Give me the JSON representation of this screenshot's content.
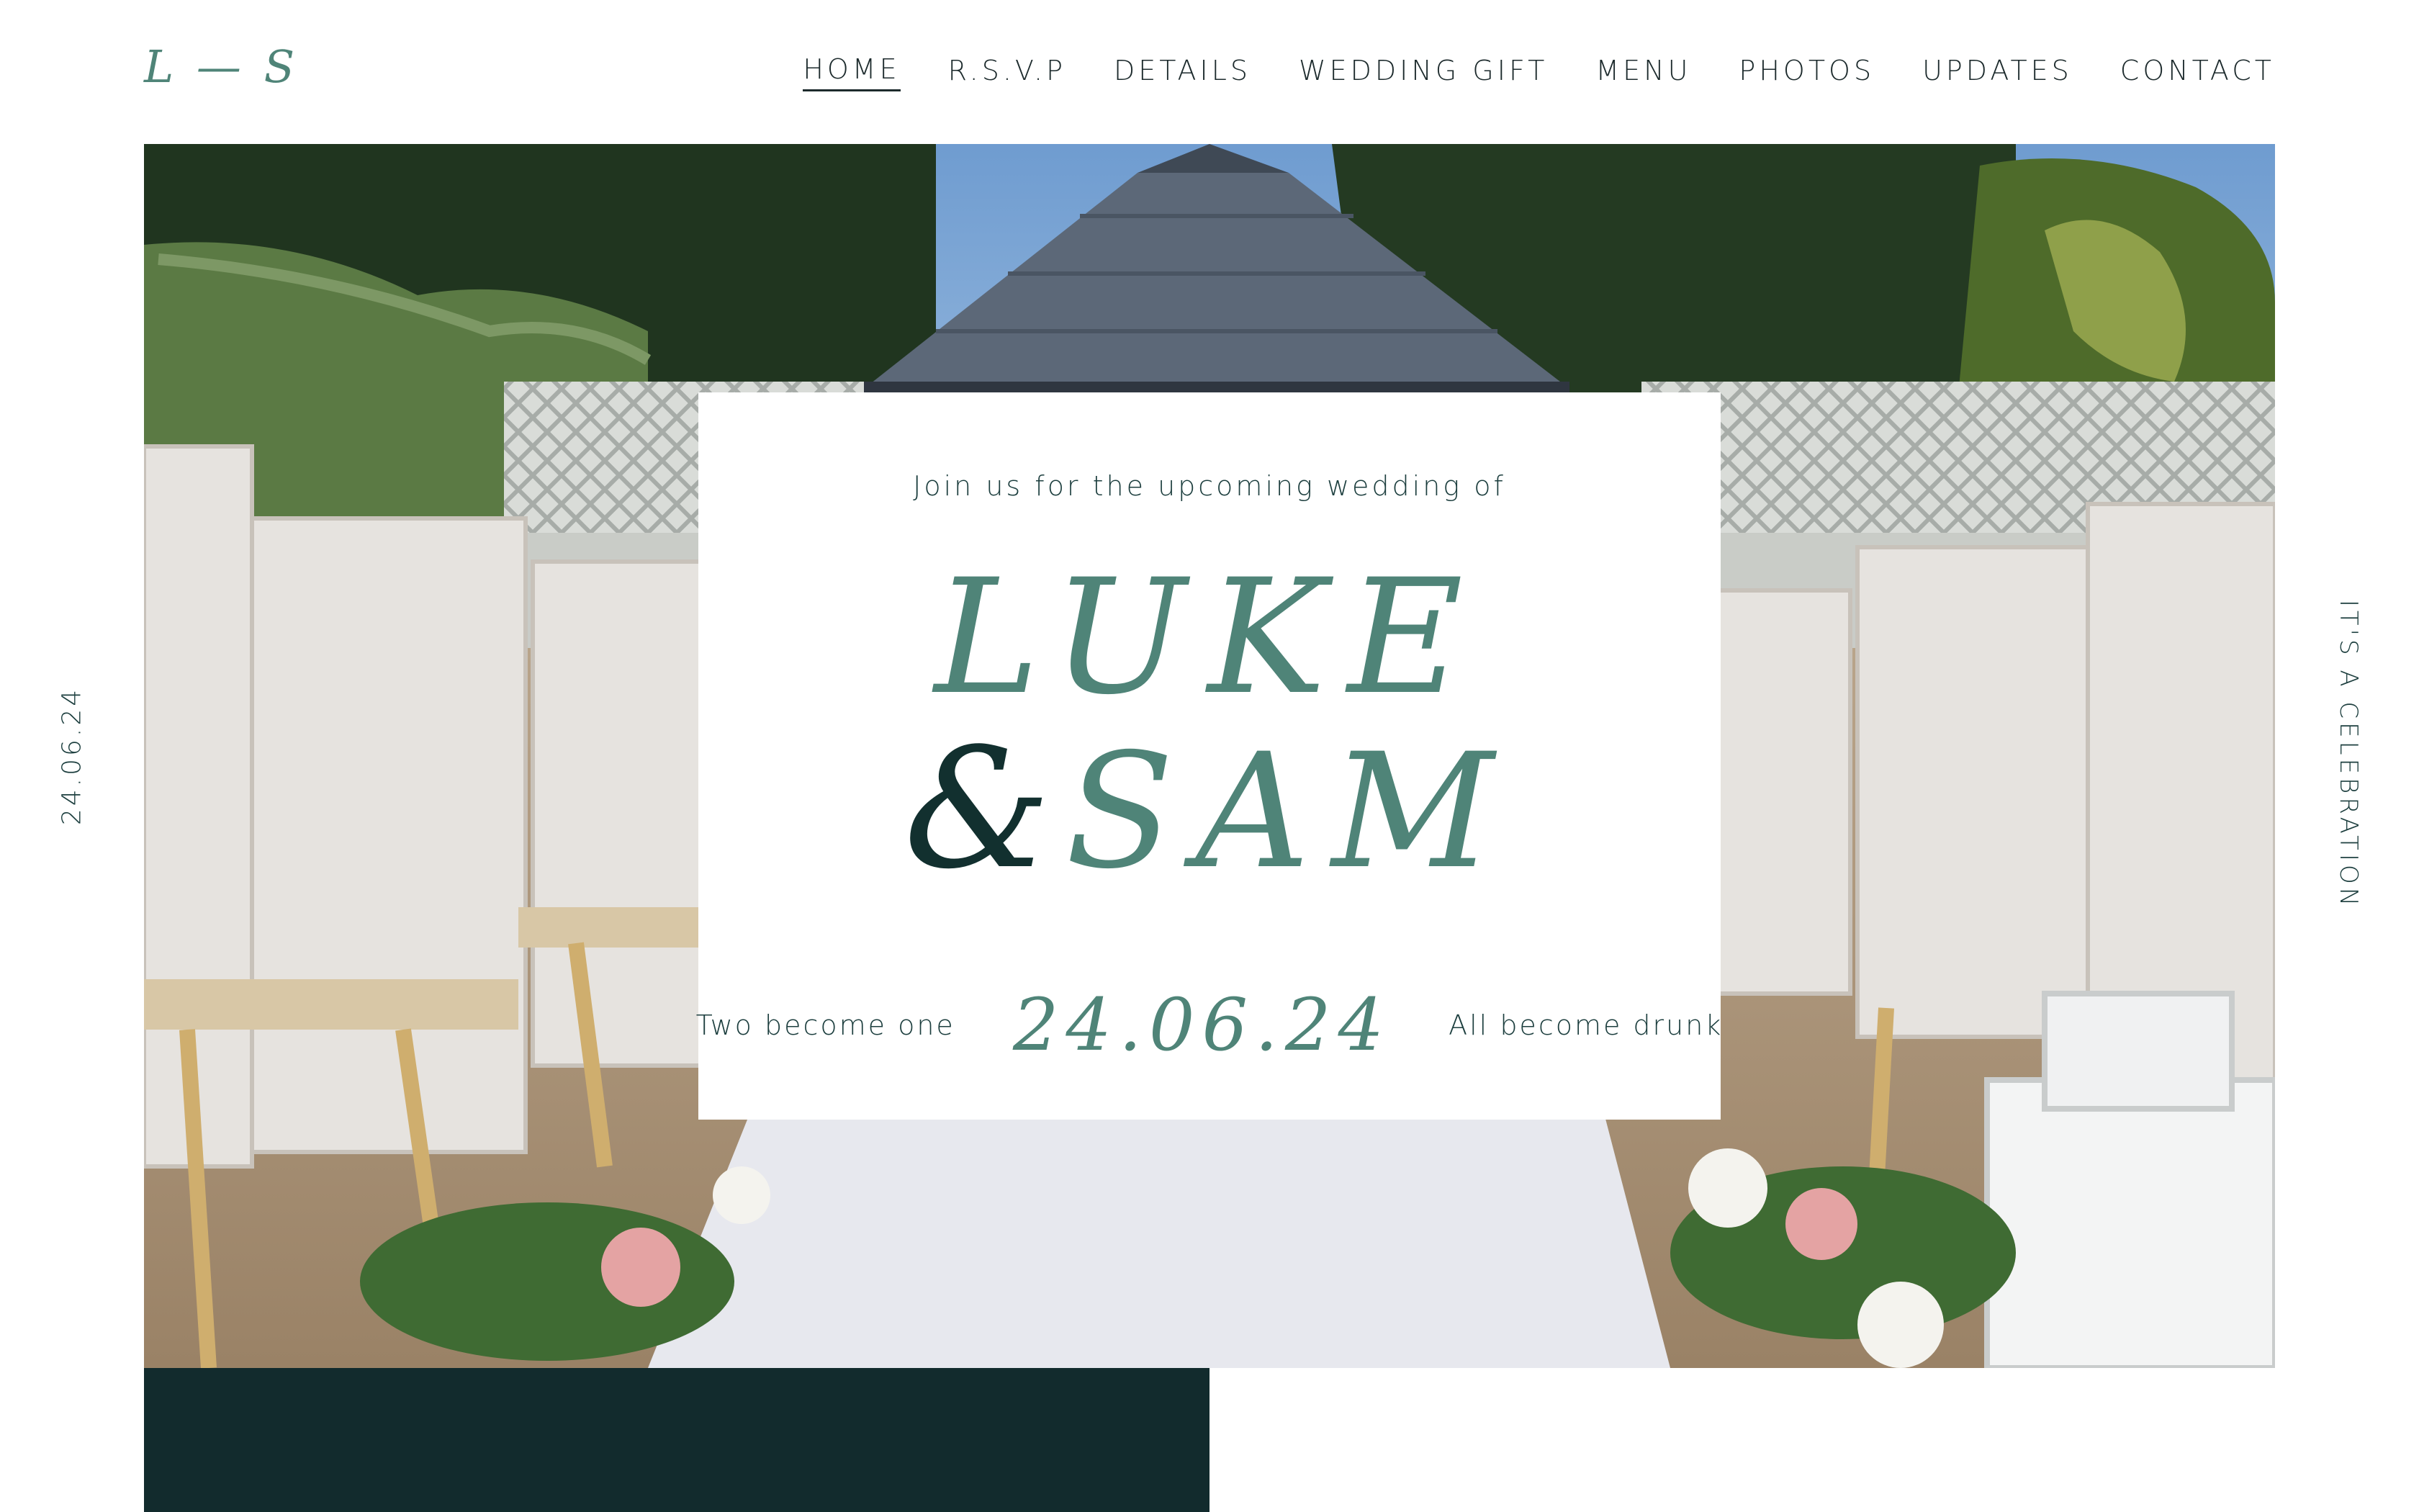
{
  "header": {
    "logo": "L — S",
    "nav": [
      {
        "label": "HOME",
        "active": true
      },
      {
        "label": "R.S.V.P",
        "active": false
      },
      {
        "label": "DETAILS",
        "active": false
      },
      {
        "label": "WEDDING GIFT",
        "active": false
      },
      {
        "label": "MENU",
        "active": false
      },
      {
        "label": "PHOTOS",
        "active": false
      },
      {
        "label": "UPDATES",
        "active": false
      },
      {
        "label": "CONTACT",
        "active": false
      }
    ]
  },
  "side": {
    "left": "24.06.24",
    "right": "IT'S A CELEBRATION"
  },
  "card": {
    "intro": "Join us for the upcoming wedding of",
    "name1": "LUKE",
    "ampersand": "&",
    "name2": "SAM",
    "tag_left": "Two become one",
    "date": "24.06.24",
    "tag_right": "All become drunk"
  },
  "colors": {
    "accent": "#4f8478",
    "dark": "#122b2d",
    "dot": "#d7b98a"
  }
}
